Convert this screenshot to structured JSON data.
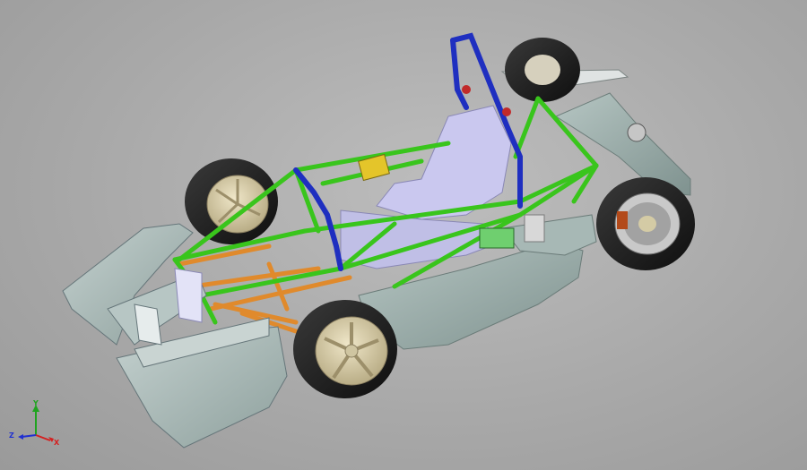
{
  "viewport": {
    "background": "#a9a9a9",
    "colors": {
      "frame_main": "#39c51c",
      "roll_hoop": "#1f2fc0",
      "suspension_arms": "#e08a2c",
      "bodywork": "#9fb0ad",
      "seat": "#c9c7ee",
      "tire": "#1c1c1c",
      "rim": "#d8cfae"
    }
  },
  "model": {
    "parts": {
      "front_wing": "front-wing-icon",
      "chassis_frame": "tubular-frame-icon",
      "main_roll_hoop": "roll-hoop-icon",
      "seat": "seat-icon",
      "sidepod": "sidepod-icon",
      "rear_wing": "rear-wing-icon",
      "wheels": [
        "front-left-wheel",
        "front-right-wheel",
        "rear-left-wheel",
        "rear-right-wheel"
      ]
    }
  },
  "triad": {
    "axis_x": "X",
    "axis_y": "Y",
    "axis_z": "Z",
    "colors": {
      "x": "#d42020",
      "y": "#1fa31f",
      "z": "#2030d0"
    }
  }
}
